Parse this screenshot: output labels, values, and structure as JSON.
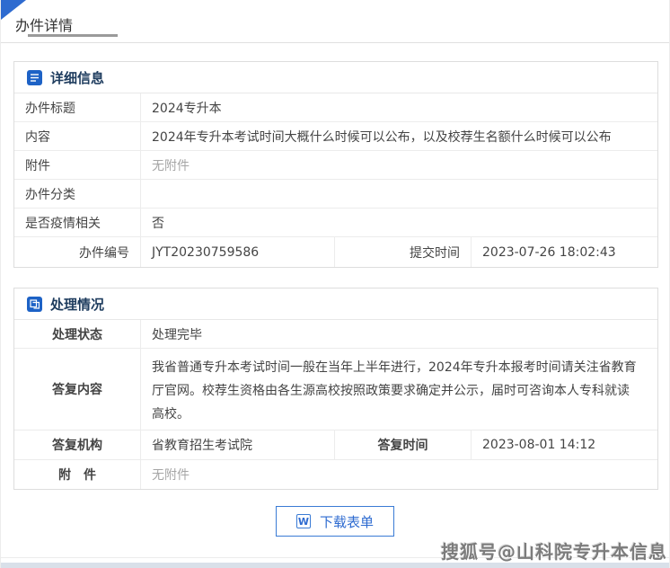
{
  "colors": {
    "accent_blue": "#2e6bd0",
    "icon_blue": "#1d62c6",
    "section_title": "#1e3c5e",
    "muted_text": "#a6a6a6"
  },
  "tab": {
    "title": "办件详情"
  },
  "detail": {
    "title": "详细信息",
    "icon": "document-list-icon",
    "rows": [
      {
        "label": "办件标题",
        "value": "2024专升本"
      },
      {
        "label": "内容",
        "value": "2024年专升本考试时间大概什么时候可以公布，以及校荐生名额什么时候可以公布"
      },
      {
        "label": "附件",
        "value": "无附件"
      },
      {
        "label": "办件分类",
        "value": ""
      },
      {
        "label": "是否疫情相关",
        "value": "否"
      }
    ],
    "footer_row": {
      "label1": "办件编号",
      "value1": "JYT20230759586",
      "label2": "提交时间",
      "value2": "2023-07-26 18:02:43"
    }
  },
  "process": {
    "title": "处理情况",
    "icon": "documents-copy-icon",
    "status_row": {
      "label": "处理状态",
      "value": "处理完毕"
    },
    "reply_row": {
      "label": "答复内容",
      "value": "我省普通专升本考试时间一般在当年上半年进行，2024年专升本报考时间请关注省教育厅官网。校荐生资格由各生源高校按照政策要求确定并公示，届时可咨询本人专科就读高校。"
    },
    "org_row": {
      "label1": "答复机构",
      "value1": "省教育招生考试院",
      "label2": "答复时间",
      "value2": "2023-08-01 14:12"
    },
    "attachment_row": {
      "label": "附　件",
      "value": "无附件"
    }
  },
  "actions": {
    "download_label": "下载表单",
    "download_icon_letter": "W"
  },
  "watermark": {
    "text": "搜狐号@山科院专升本信息"
  }
}
